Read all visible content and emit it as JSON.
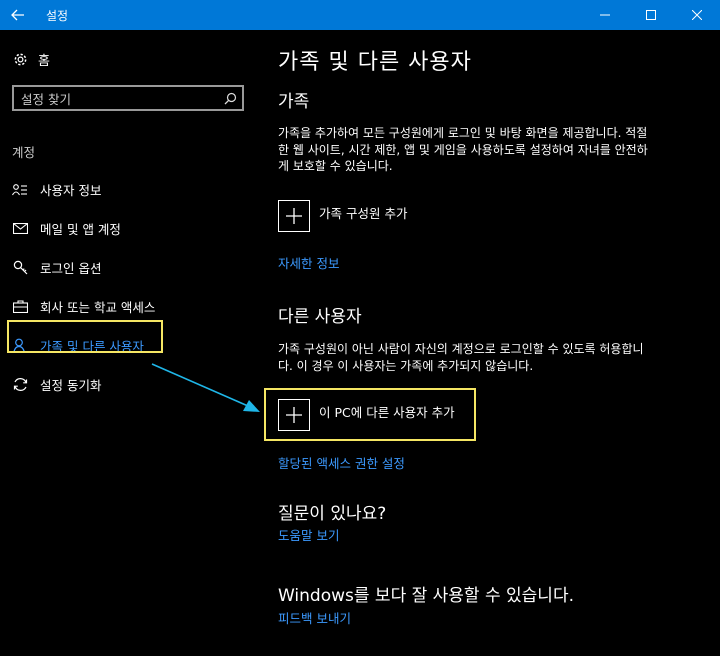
{
  "window": {
    "title": "설정"
  },
  "sidebar": {
    "home_label": "홈",
    "search_placeholder": "설정 찾기",
    "section_label": "계정",
    "items": [
      {
        "label": "사용자 정보",
        "icon": "user-info-icon"
      },
      {
        "label": "메일 및 앱 계정",
        "icon": "mail-icon"
      },
      {
        "label": "로그인 옵션",
        "icon": "key-icon"
      },
      {
        "label": "회사 또는 학교 액세스",
        "icon": "briefcase-icon"
      },
      {
        "label": "가족 및 다른 사용자",
        "icon": "person-icon",
        "active": true
      },
      {
        "label": "설정 동기화",
        "icon": "sync-icon"
      }
    ]
  },
  "main": {
    "title": "가족 및 다른 사용자",
    "family": {
      "heading": "가족",
      "description": "가족을 추가하여 모든 구성원에게 로그인 및 바탕 화면을 제공합니다. 적절한 웹 사이트, 시간 제한, 앱 및 게임을 사용하도록 설정하여 자녀를 안전하게 보호할 수 있습니다.",
      "add_label": "가족 구성원 추가",
      "link": "자세한 정보"
    },
    "others": {
      "heading": "다른 사용자",
      "description": "가족 구성원이 아닌 사람이 자신의 계정으로 로그인할 수 있도록 허용합니다. 이 경우 이 사용자는 가족에 추가되지 않습니다.",
      "add_label": "이 PC에 다른 사용자 추가",
      "link": "할당된 액세스 권한 설정"
    },
    "question": {
      "heading": "질문이 있나요?",
      "link": "도움말 보기"
    },
    "feedback": {
      "heading": "Windows를 보다 잘 사용할 수 있습니다.",
      "link": "피드백 보내기"
    }
  },
  "colors": {
    "titlebar": "#0078d7",
    "accent": "#3c9aff",
    "highlight": "#f5e663",
    "arrow": "#1fb6e8",
    "background": "#000000"
  }
}
